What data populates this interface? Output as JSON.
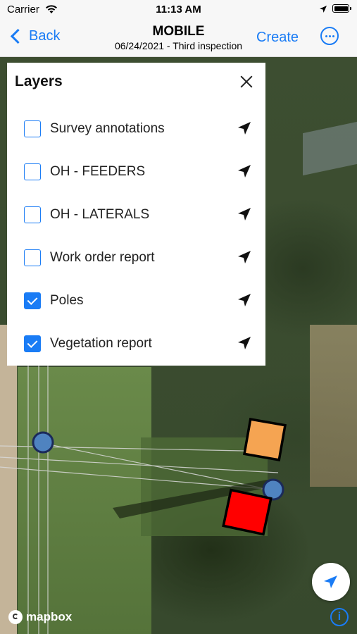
{
  "status_bar": {
    "carrier": "Carrier",
    "time": "11:13 AM",
    "icons": [
      "wifi-icon",
      "location-arrow-icon",
      "battery-icon"
    ]
  },
  "nav": {
    "back_label": "Back",
    "title": "MOBILE",
    "subtitle": "06/24/2021 - Third inspection",
    "create_label": "Create",
    "more_icon": "ellipsis-circle-icon"
  },
  "layers_panel": {
    "title": "Layers",
    "close_icon": "close-icon",
    "items": [
      {
        "label": "Survey annotations",
        "checked": false
      },
      {
        "label": "OH - FEEDERS",
        "checked": false
      },
      {
        "label": "OH - LATERALS",
        "checked": false
      },
      {
        "label": "Work order report",
        "checked": false
      },
      {
        "label": "Poles",
        "checked": true
      },
      {
        "label": "Vegetation report",
        "checked": true
      }
    ]
  },
  "map": {
    "attribution": "mapbox",
    "colors": {
      "pole_marker": "#4f83c0",
      "vegetation_orange": "#f5a452",
      "vegetation_red": "#ff0000",
      "accent": "#1a7cf5"
    }
  }
}
